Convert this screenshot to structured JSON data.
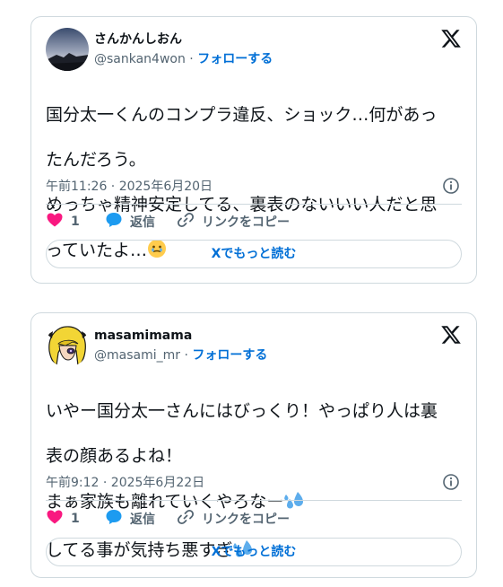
{
  "tweets": [
    {
      "author_name": "さんかんしおん",
      "handle": "@sankan4won",
      "separator": " · ",
      "follow_label": "フォローする",
      "text_lines": [
        "国分太一くんのコンプラ違反、ショック…何があっ",
        "たんだろう。",
        "めっちゃ精神安定してる、裏表のないいい人だと思",
        "っていたよ…"
      ],
      "trailing_emoji": "face-holding-back-tears",
      "timestamp": "午前11:26 · 2025年6月20日",
      "like_count": "1",
      "reply_label": "返信",
      "copy_link_label": "リンクをコピー",
      "read_more_label": "Xでもっと読む"
    },
    {
      "author_name": "masamimama",
      "handle": "@masami_mr",
      "separator": " · ",
      "follow_label": "フォローする",
      "text_lines": [
        "いやー国分太一さんにはびっくり！やっぱり人は裏",
        "表の顔あるよね！",
        "まぁ家族も離れていくやろなー",
        "してる事が気持ち悪すぎ"
      ],
      "trailing_emoji": "sweat-droplets",
      "timestamp": "午前9:12 · 2025年6月22日",
      "like_count": "1",
      "reply_label": "返信",
      "copy_link_label": "リンクをコピー",
      "read_more_label": "Xでもっと読む"
    }
  ],
  "colors": {
    "accent": "#006fd6",
    "like": "#f91880",
    "reply": "#1d9bf0",
    "muted": "#536471",
    "border": "#cfd9de"
  }
}
